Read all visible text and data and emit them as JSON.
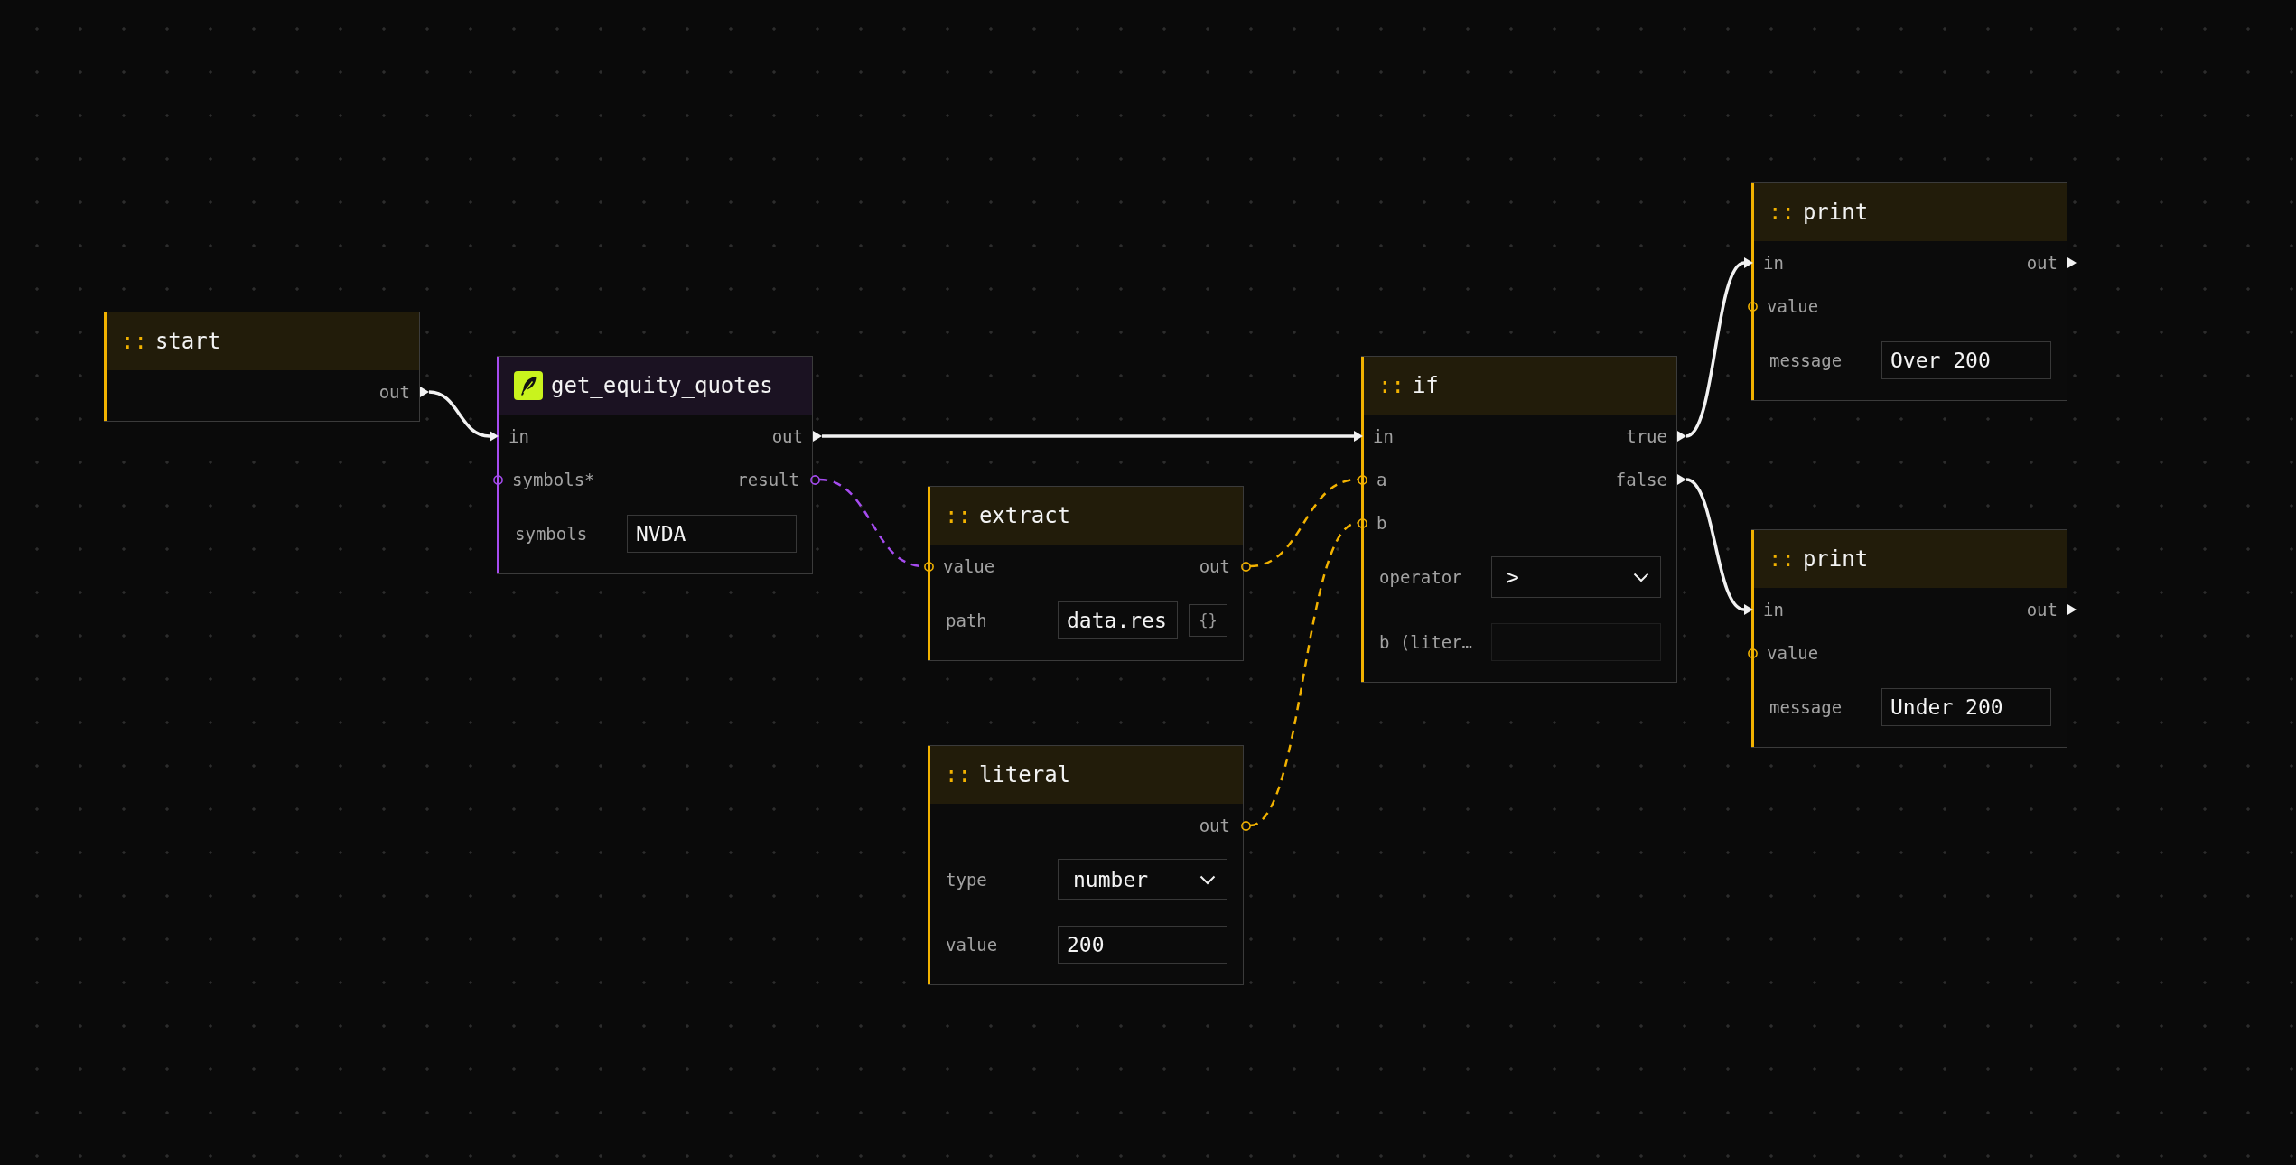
{
  "nodes": [
    {
      "kind": "builtin",
      "prefix": "::",
      "title": "start",
      "color": "#f2b200",
      "rows": [
        {
          "output": {
            "label": "out",
            "kind": "exec"
          }
        }
      ]
    },
    {
      "kind": "tool",
      "title": "get_equity_quotes",
      "color": "#a64cf0",
      "rows": [
        {
          "input": {
            "label": "in",
            "kind": "exec"
          },
          "output": {
            "label": "out",
            "kind": "exec"
          }
        },
        {
          "input": {
            "label": "symbols*",
            "kind": "data"
          },
          "output": {
            "label": "result",
            "kind": "data"
          }
        }
      ],
      "fields": [
        {
          "kind": "text",
          "label": "symbols",
          "value": "NVDA",
          "disabled": false
        }
      ]
    },
    {
      "kind": "builtin",
      "prefix": "::",
      "title": "extract",
      "color": "#f2b200",
      "rows": [
        {
          "input": {
            "label": "value",
            "kind": "data"
          },
          "output": {
            "label": "out",
            "kind": "data"
          }
        }
      ],
      "fields": [
        {
          "kind": "text",
          "label": "path",
          "value": "data.res",
          "button": "{}",
          "disabled": false
        }
      ]
    },
    {
      "kind": "builtin",
      "prefix": "::",
      "title": "literal",
      "color": "#f2b200",
      "rows": [
        {
          "output": {
            "label": "out",
            "kind": "data"
          }
        }
      ],
      "fields": [
        {
          "kind": "select",
          "label": "type",
          "value": "number",
          "disabled": false
        },
        {
          "kind": "text",
          "label": "value",
          "value": "200",
          "disabled": false
        }
      ]
    },
    {
      "kind": "builtin",
      "prefix": "::",
      "title": "if",
      "color": "#f2b200",
      "rows": [
        {
          "input": {
            "label": "in",
            "kind": "exec"
          },
          "output": {
            "label": "true",
            "kind": "exec"
          }
        },
        {
          "input": {
            "label": "a",
            "kind": "data"
          },
          "output": {
            "label": "false",
            "kind": "exec"
          }
        },
        {
          "input": {
            "label": "b",
            "kind": "data"
          }
        }
      ],
      "fields": [
        {
          "kind": "select",
          "label": "operator",
          "value": ">",
          "disabled": false
        },
        {
          "kind": "text",
          "label": "b (liter…",
          "disabled": true
        }
      ]
    },
    {
      "kind": "builtin",
      "prefix": "::",
      "title": "print",
      "color": "#f2b200",
      "rows": [
        {
          "input": {
            "label": "in",
            "kind": "exec"
          },
          "output": {
            "label": "out",
            "kind": "exec"
          }
        },
        {
          "input": {
            "label": "value",
            "kind": "data"
          }
        }
      ],
      "fields": [
        {
          "kind": "text",
          "label": "message",
          "value": "Over 200",
          "disabled": false
        }
      ]
    },
    {
      "kind": "builtin",
      "prefix": "::",
      "title": "print",
      "color": "#f2b200",
      "rows": [
        {
          "input": {
            "label": "in",
            "kind": "exec"
          },
          "output": {
            "label": "out",
            "kind": "exec"
          }
        },
        {
          "input": {
            "label": "value",
            "kind": "data"
          }
        }
      ],
      "fields": [
        {
          "kind": "text",
          "label": "message",
          "value": "Under 200",
          "disabled": false
        }
      ]
    }
  ],
  "edges": [
    {
      "kind": "exec"
    },
    {
      "kind": "exec"
    },
    {
      "kind": "data"
    },
    {
      "kind": "data"
    },
    {
      "kind": "data"
    },
    {
      "kind": "exec"
    },
    {
      "kind": "exec"
    }
  ]
}
